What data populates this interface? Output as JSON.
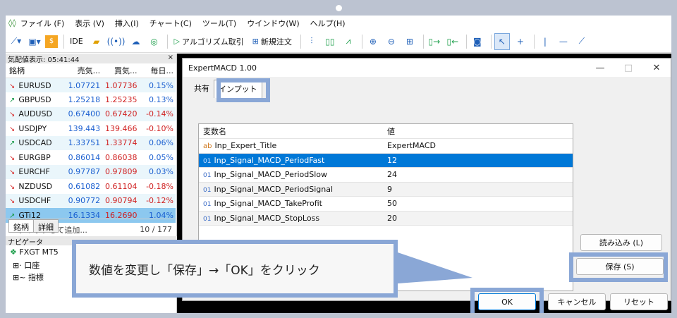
{
  "menu": [
    "ファイル (F)",
    "表示 (V)",
    "挿入(I)",
    "チャート(C)",
    "ツール(T)",
    "ウインドウ(W)",
    "ヘルプ(H)"
  ],
  "toolbar": {
    "ide": "IDE",
    "algo_trading": "アルゴリズム取引",
    "new_order": "新規注文"
  },
  "market_watch": {
    "header": "気配値表示: 05:41:44",
    "close": "×",
    "columns": [
      "銘柄",
      "売気...",
      "買気...",
      "毎日..."
    ],
    "rows": [
      {
        "dir": "↘",
        "symbol": "EURUSD",
        "bid": "1.07721",
        "ask": "1.07736",
        "change": "0.15%"
      },
      {
        "dir": "↗",
        "symbol": "GBPUSD",
        "bid": "1.25218",
        "ask": "1.25235",
        "change": "0.13%"
      },
      {
        "dir": "↘",
        "symbol": "AUDUSD",
        "bid": "0.67400",
        "ask": "0.67420",
        "change": "-0.14%"
      },
      {
        "dir": "↘",
        "symbol": "USDJPY",
        "bid": "139.443",
        "ask": "139.466",
        "change": "-0.10%"
      },
      {
        "dir": "↗",
        "symbol": "USDCAD",
        "bid": "1.33751",
        "ask": "1.33774",
        "change": "0.06%"
      },
      {
        "dir": "↘",
        "symbol": "EURGBP",
        "bid": "0.86014",
        "ask": "0.86038",
        "change": "0.05%"
      },
      {
        "dir": "↘",
        "symbol": "EURCHF",
        "bid": "0.97787",
        "ask": "0.97809",
        "change": "0.03%"
      },
      {
        "dir": "↘",
        "symbol": "NZDUSD",
        "bid": "0.61082",
        "ask": "0.61104",
        "change": "-0.18%"
      },
      {
        "dir": "↘",
        "symbol": "USDCHF",
        "bid": "0.90772",
        "ask": "0.90794",
        "change": "-0.12%"
      },
      {
        "dir": "↗",
        "symbol": "GTi12",
        "bid": "16.1334",
        "ask": "16.2690",
        "change": "1.04%"
      }
    ],
    "add_label": "+ クリックして追加...",
    "count": "10 / 177",
    "tabs": [
      "銘柄",
      "詳細"
    ]
  },
  "navigator": {
    "header": "ナビゲータ",
    "items": [
      "FXGT MT5",
      "口座",
      "指標"
    ]
  },
  "dialog": {
    "title": "ExpertMACD 1.00",
    "tabs": [
      "共有",
      "インプット"
    ],
    "columns": [
      "変数名",
      "値"
    ],
    "params": [
      {
        "type": "ab",
        "name": "Inp_Expert_Title",
        "value": "ExpertMACD"
      },
      {
        "type": "01",
        "name": "Inp_Signal_MACD_PeriodFast",
        "value": "12"
      },
      {
        "type": "01",
        "name": "Inp_Signal_MACD_PeriodSlow",
        "value": "24"
      },
      {
        "type": "01",
        "name": "Inp_Signal_MACD_PeriodSignal",
        "value": "9"
      },
      {
        "type": "01",
        "name": "Inp_Signal_MACD_TakeProfit",
        "value": "50"
      },
      {
        "type": "01",
        "name": "Inp_Signal_MACD_StopLoss",
        "value": "20"
      }
    ],
    "load_button": "読み込み (L)",
    "save_button": "保存 (S)",
    "ok_button": "OK",
    "cancel_button": "キャンセル",
    "reset_button": "リセット"
  },
  "callout": "数値を変更し「保存」→「OK」をクリック"
}
